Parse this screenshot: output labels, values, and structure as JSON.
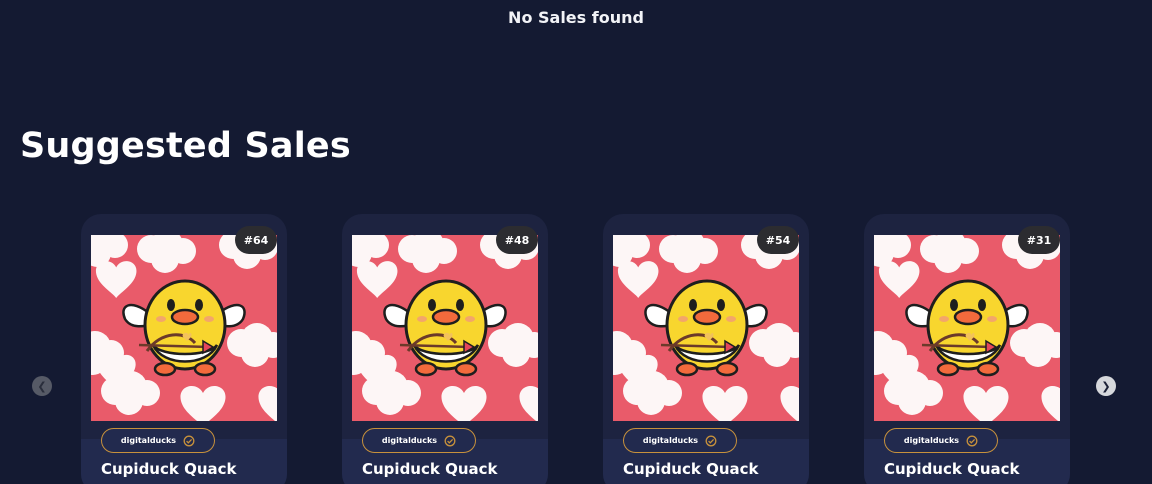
{
  "status": {
    "message": "No Sales found"
  },
  "section": {
    "title": "Suggested Sales"
  },
  "colors": {
    "background": "#141a32",
    "card": "#1d2340",
    "artwork_background": "#e95b6a",
    "pill_border": "#c7913c"
  },
  "carousel": {
    "prev_icon": "chevron-left-icon",
    "next_icon": "chevron-right-icon",
    "cards": [
      {
        "token": "#64",
        "collection": "digitalducks",
        "verified_icon": "verified-check-icon",
        "title": "Cupiduck Quack"
      },
      {
        "token": "#48",
        "collection": "digitalducks",
        "verified_icon": "verified-check-icon",
        "title": "Cupiduck Quack"
      },
      {
        "token": "#54",
        "collection": "digitalducks",
        "verified_icon": "verified-check-icon",
        "title": "Cupiduck Quack"
      },
      {
        "token": "#31",
        "collection": "digitalducks",
        "verified_icon": "verified-check-icon",
        "title": "Cupiduck Quack"
      }
    ]
  }
}
